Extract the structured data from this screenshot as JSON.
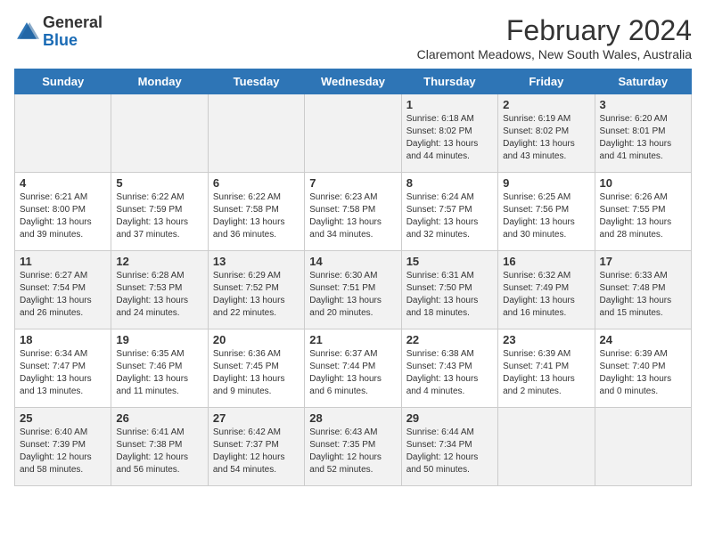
{
  "header": {
    "logo_general": "General",
    "logo_blue": "Blue",
    "month_year": "February 2024",
    "location": "Claremont Meadows, New South Wales, Australia"
  },
  "days_of_week": [
    "Sunday",
    "Monday",
    "Tuesday",
    "Wednesday",
    "Thursday",
    "Friday",
    "Saturday"
  ],
  "weeks": [
    [
      {
        "day": "",
        "info": ""
      },
      {
        "day": "",
        "info": ""
      },
      {
        "day": "",
        "info": ""
      },
      {
        "day": "",
        "info": ""
      },
      {
        "day": "1",
        "info": "Sunrise: 6:18 AM\nSunset: 8:02 PM\nDaylight: 13 hours\nand 44 minutes."
      },
      {
        "day": "2",
        "info": "Sunrise: 6:19 AM\nSunset: 8:02 PM\nDaylight: 13 hours\nand 43 minutes."
      },
      {
        "day": "3",
        "info": "Sunrise: 6:20 AM\nSunset: 8:01 PM\nDaylight: 13 hours\nand 41 minutes."
      }
    ],
    [
      {
        "day": "4",
        "info": "Sunrise: 6:21 AM\nSunset: 8:00 PM\nDaylight: 13 hours\nand 39 minutes."
      },
      {
        "day": "5",
        "info": "Sunrise: 6:22 AM\nSunset: 7:59 PM\nDaylight: 13 hours\nand 37 minutes."
      },
      {
        "day": "6",
        "info": "Sunrise: 6:22 AM\nSunset: 7:58 PM\nDaylight: 13 hours\nand 36 minutes."
      },
      {
        "day": "7",
        "info": "Sunrise: 6:23 AM\nSunset: 7:58 PM\nDaylight: 13 hours\nand 34 minutes."
      },
      {
        "day": "8",
        "info": "Sunrise: 6:24 AM\nSunset: 7:57 PM\nDaylight: 13 hours\nand 32 minutes."
      },
      {
        "day": "9",
        "info": "Sunrise: 6:25 AM\nSunset: 7:56 PM\nDaylight: 13 hours\nand 30 minutes."
      },
      {
        "day": "10",
        "info": "Sunrise: 6:26 AM\nSunset: 7:55 PM\nDaylight: 13 hours\nand 28 minutes."
      }
    ],
    [
      {
        "day": "11",
        "info": "Sunrise: 6:27 AM\nSunset: 7:54 PM\nDaylight: 13 hours\nand 26 minutes."
      },
      {
        "day": "12",
        "info": "Sunrise: 6:28 AM\nSunset: 7:53 PM\nDaylight: 13 hours\nand 24 minutes."
      },
      {
        "day": "13",
        "info": "Sunrise: 6:29 AM\nSunset: 7:52 PM\nDaylight: 13 hours\nand 22 minutes."
      },
      {
        "day": "14",
        "info": "Sunrise: 6:30 AM\nSunset: 7:51 PM\nDaylight: 13 hours\nand 20 minutes."
      },
      {
        "day": "15",
        "info": "Sunrise: 6:31 AM\nSunset: 7:50 PM\nDaylight: 13 hours\nand 18 minutes."
      },
      {
        "day": "16",
        "info": "Sunrise: 6:32 AM\nSunset: 7:49 PM\nDaylight: 13 hours\nand 16 minutes."
      },
      {
        "day": "17",
        "info": "Sunrise: 6:33 AM\nSunset: 7:48 PM\nDaylight: 13 hours\nand 15 minutes."
      }
    ],
    [
      {
        "day": "18",
        "info": "Sunrise: 6:34 AM\nSunset: 7:47 PM\nDaylight: 13 hours\nand 13 minutes."
      },
      {
        "day": "19",
        "info": "Sunrise: 6:35 AM\nSunset: 7:46 PM\nDaylight: 13 hours\nand 11 minutes."
      },
      {
        "day": "20",
        "info": "Sunrise: 6:36 AM\nSunset: 7:45 PM\nDaylight: 13 hours\nand 9 minutes."
      },
      {
        "day": "21",
        "info": "Sunrise: 6:37 AM\nSunset: 7:44 PM\nDaylight: 13 hours\nand 6 minutes."
      },
      {
        "day": "22",
        "info": "Sunrise: 6:38 AM\nSunset: 7:43 PM\nDaylight: 13 hours\nand 4 minutes."
      },
      {
        "day": "23",
        "info": "Sunrise: 6:39 AM\nSunset: 7:41 PM\nDaylight: 13 hours\nand 2 minutes."
      },
      {
        "day": "24",
        "info": "Sunrise: 6:39 AM\nSunset: 7:40 PM\nDaylight: 13 hours\nand 0 minutes."
      }
    ],
    [
      {
        "day": "25",
        "info": "Sunrise: 6:40 AM\nSunset: 7:39 PM\nDaylight: 12 hours\nand 58 minutes."
      },
      {
        "day": "26",
        "info": "Sunrise: 6:41 AM\nSunset: 7:38 PM\nDaylight: 12 hours\nand 56 minutes."
      },
      {
        "day": "27",
        "info": "Sunrise: 6:42 AM\nSunset: 7:37 PM\nDaylight: 12 hours\nand 54 minutes."
      },
      {
        "day": "28",
        "info": "Sunrise: 6:43 AM\nSunset: 7:35 PM\nDaylight: 12 hours\nand 52 minutes."
      },
      {
        "day": "29",
        "info": "Sunrise: 6:44 AM\nSunset: 7:34 PM\nDaylight: 12 hours\nand 50 minutes."
      },
      {
        "day": "",
        "info": ""
      },
      {
        "day": "",
        "info": ""
      }
    ]
  ]
}
